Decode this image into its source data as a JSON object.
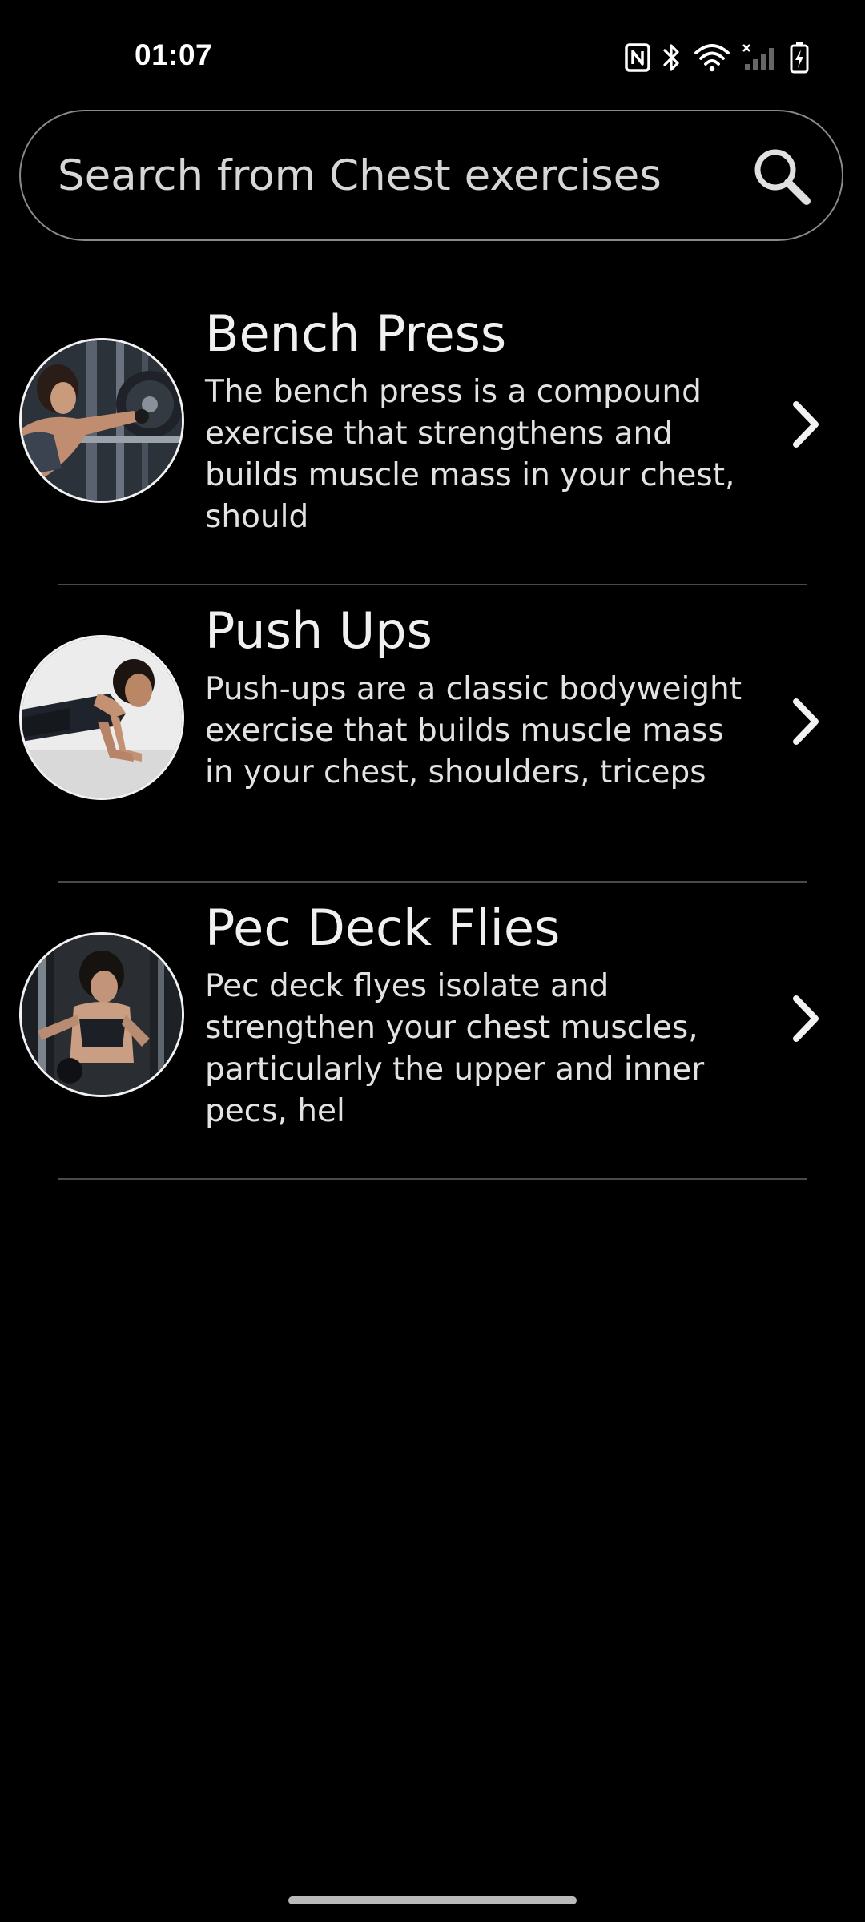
{
  "status_bar": {
    "time": "01:07",
    "icons": [
      "nfc-icon",
      "bluetooth-icon",
      "wifi-icon",
      "signal-icon",
      "battery-charging-icon"
    ]
  },
  "search": {
    "placeholder": "Search from Chest exercises",
    "value": "",
    "icon": "search-icon"
  },
  "exercises": [
    {
      "title": "Bench Press",
      "description": "The bench press is a compound exercise that strengthens and builds muscle mass in your chest, should",
      "image": "woman-at-weight-rack-photo"
    },
    {
      "title": "Push Ups",
      "description": "Push-ups are a classic bodyweight exercise that builds muscle mass in your chest, shoulders, triceps",
      "image": "woman-in-plank-position-photo"
    },
    {
      "title": "Pec Deck Flies",
      "description": "Pec deck flyes isolate and strengthen your chest muscles, particularly the upper and inner pecs, hel",
      "image": "woman-on-pec-deck-machine-photo"
    }
  ],
  "colors": {
    "background": "#000000",
    "text": "#ececec",
    "search_border": "#8a8a8a",
    "divider": "#4a4a4a",
    "nav_handle": "#b9b9b9"
  }
}
